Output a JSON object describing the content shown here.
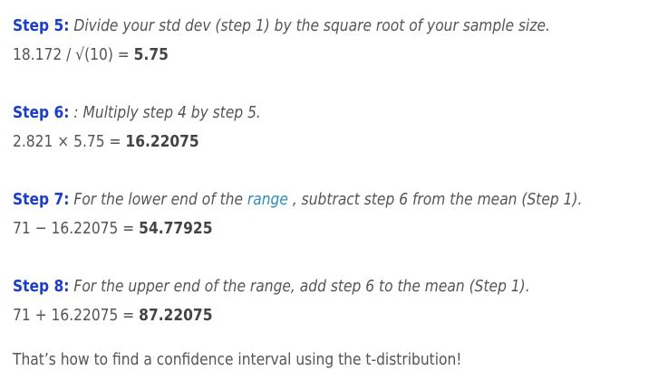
{
  "steps": [
    {
      "label": "Step 5:",
      "instruction": "Divide your std dev (step 1) by the square root of your sample size.",
      "calc": "18.172 / √(10) = ",
      "result": "5.75"
    },
    {
      "label": "Step 6:",
      "instruction_prefix": ": Multiply step 4 by step 5.",
      "calc": "2.821 × 5.75 = ",
      "result": "16.22075"
    },
    {
      "label": "Step 7:",
      "instruction_before": "For the lower end of the ",
      "link_text": "range",
      "instruction_after": " , subtract step 6 from the mean (Step 1).",
      "calc": "71  − 16.22075 = ",
      "result": "54.77925"
    },
    {
      "label": "Step 8:",
      "instruction": "For the upper end of the range, add step 6 to the mean (Step 1).",
      "calc": "71 + 16.22075 = ",
      "result": "87.22075"
    }
  ],
  "conclusion": "That’s how to find a confidence interval using the t-distribution!",
  "colors": {
    "label": "#1a3fc6",
    "link": "#2e8bb8",
    "text": "#555555"
  }
}
